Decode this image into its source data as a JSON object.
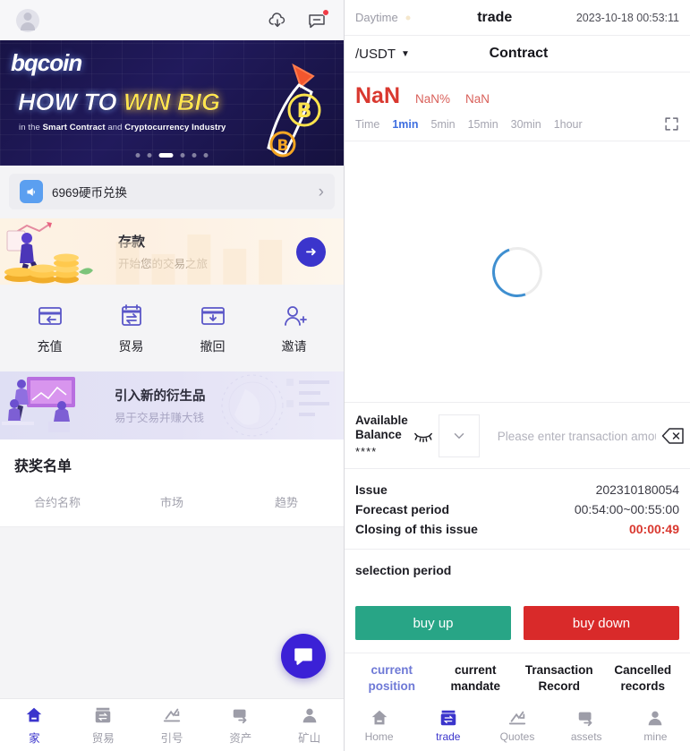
{
  "left": {
    "header": {
      "avatar": "user-avatar",
      "cloud_icon": "cloud-download-icon",
      "message_icon": "message-icon",
      "has_notification": true
    },
    "banner": {
      "logo": "bqcoin",
      "headline_1": "HOW TO ",
      "headline_2": "WIN BIG",
      "sub_1": "in the ",
      "sub_2": "Smart Contract",
      "sub_3": " and ",
      "sub_4": "Cryptocurrency Industry",
      "dot_count": 6,
      "active_dot": 3
    },
    "notice": {
      "text": "6969硬币兑换",
      "chevron": "›"
    },
    "promo_deposit": {
      "title": "存款",
      "desc": "开始您的交易之旅",
      "arrow": "➜"
    },
    "quick_actions": [
      {
        "label": "充值",
        "icon": "recharge-icon"
      },
      {
        "label": "贸易",
        "icon": "trade-icon"
      },
      {
        "label": "撤回",
        "icon": "withdraw-icon"
      },
      {
        "label": "邀请",
        "icon": "invite-icon"
      }
    ],
    "promo_derivative": {
      "title": "引入新的衍生品",
      "desc": "易于交易并赚大钱"
    },
    "winners": {
      "title": "获奖名单",
      "columns": [
        "合约名称",
        "市场",
        "趋势"
      ],
      "rows": []
    },
    "chat_fab": "chat-icon",
    "nav": [
      {
        "label": "家",
        "icon": "home-icon",
        "active": true
      },
      {
        "label": "贸易",
        "icon": "trade-icon",
        "active": false
      },
      {
        "label": "引号",
        "icon": "quotes-icon",
        "active": false
      },
      {
        "label": "资产",
        "icon": "assets-icon",
        "active": false
      },
      {
        "label": "矿山",
        "icon": "mine-icon",
        "active": false
      }
    ]
  },
  "right": {
    "header": {
      "daytime": "Daytime",
      "title": "trade",
      "clock": "2023-10-18 00:53:11"
    },
    "sub": {
      "pair": "/USDT",
      "caret": "▼",
      "contract": "Contract"
    },
    "price": {
      "last": "NaN",
      "change_pct": "NaN%",
      "change_abs": "NaN"
    },
    "timeframes": [
      {
        "label": "Time",
        "selected": false
      },
      {
        "label": "1min",
        "selected": true
      },
      {
        "label": "5min",
        "selected": false
      },
      {
        "label": "15min",
        "selected": false
      },
      {
        "label": "30min",
        "selected": false
      },
      {
        "label": "1hour",
        "selected": false
      }
    ],
    "chart": {
      "state": "loading"
    },
    "balance": {
      "label_line1": "Available",
      "label_line2": "Balance",
      "value": "****",
      "eye_icon": "eye-off-icon"
    },
    "amount": {
      "placeholder": "Please enter transaction amount",
      "value": "",
      "clear_icon": "backspace-icon",
      "select_icon": "chevron-down-icon"
    },
    "details": [
      {
        "key": "Issue",
        "value": "202310180054",
        "highlight": false
      },
      {
        "key": "Forecast period",
        "value": "00:54:00~00:55:00",
        "highlight": false
      },
      {
        "key": "Closing of this issue",
        "value": "00:00:49",
        "highlight": true
      }
    ],
    "selection_period_label": "selection period",
    "buttons": {
      "buy_up": "buy up",
      "buy_down": "buy down",
      "buy_up_color": "#28a586",
      "buy_down_color": "#d92a2a"
    },
    "tabs": [
      {
        "line1": "current",
        "line2": "position",
        "active": true
      },
      {
        "line1": "current",
        "line2": "mandate",
        "active": false
      },
      {
        "line1": "Transaction",
        "line2": "Record",
        "active": false
      },
      {
        "line1": "Cancelled",
        "line2": "records",
        "active": false
      }
    ],
    "nav": [
      {
        "label": "Home",
        "icon": "home-icon",
        "active": false
      },
      {
        "label": "trade",
        "icon": "trade-icon",
        "active": true
      },
      {
        "label": "Quotes",
        "icon": "quotes-icon",
        "active": false
      },
      {
        "label": "assets",
        "icon": "assets-icon",
        "active": false
      },
      {
        "label": "mine",
        "icon": "mine-icon",
        "active": false
      }
    ]
  }
}
